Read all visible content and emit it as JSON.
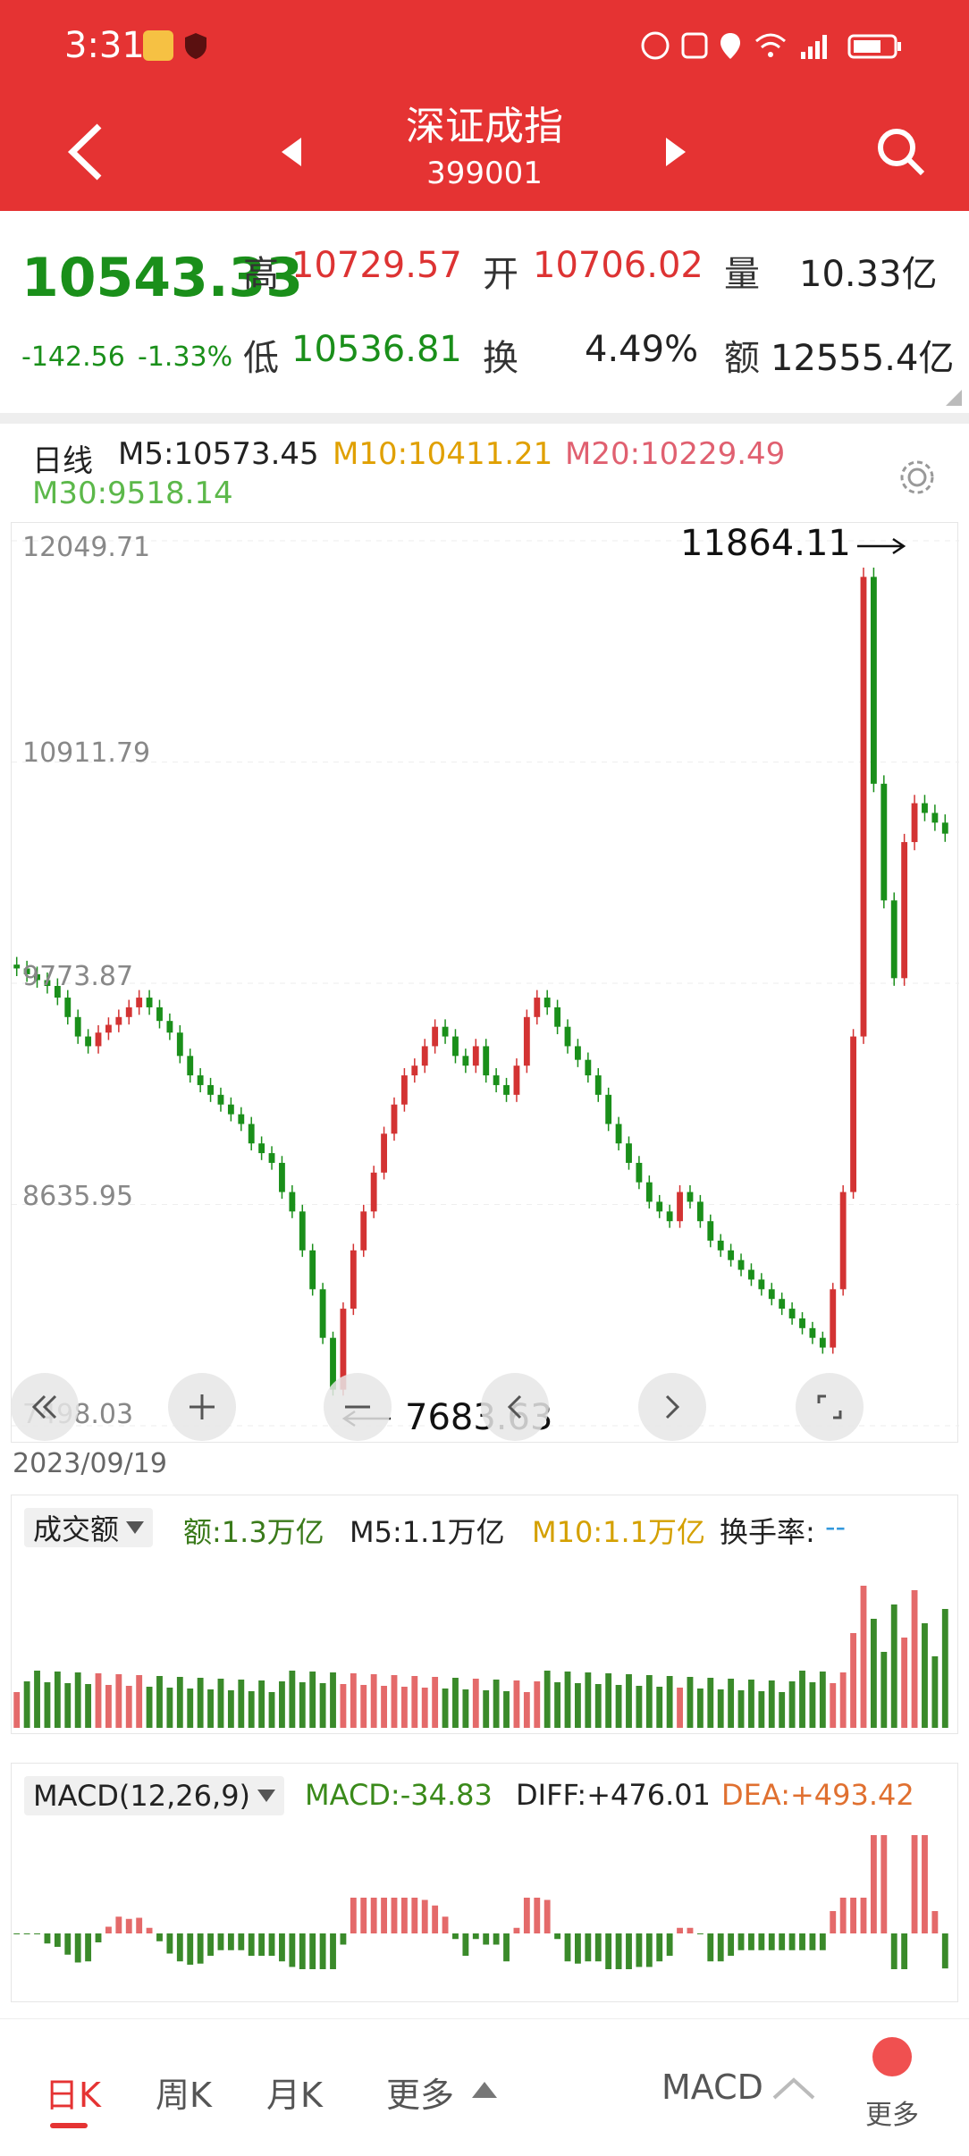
{
  "status": {
    "time": "3:31"
  },
  "nav": {
    "title": "深证成指",
    "code": "399001"
  },
  "quote": {
    "price": "10543.33",
    "change": "-142.56",
    "change_pct": "-1.33%",
    "high_label": "高",
    "high": "10729.57",
    "open_label": "开",
    "open": "10706.02",
    "volume_label": "量",
    "volume": "10.33亿",
    "low_label": "低",
    "low": "10536.81",
    "turnover_label": "换",
    "turnover": "4.49%",
    "amount_label": "额",
    "amount": "12555.4亿"
  },
  "ma": {
    "period": "日线",
    "m5": "M5:10573.45",
    "m10": "M10:10411.21",
    "m20": "M20:10229.49",
    "m30": "M30:9518.14"
  },
  "chart_axis": {
    "y_labels": [
      "12049.71",
      "10911.79",
      "9773.87",
      "8635.95",
      "7498.03"
    ],
    "max_marker": "11864.11",
    "min_marker": "7683.63",
    "start_date": "2023/09/19"
  },
  "volume_panel": {
    "selector": "成交额",
    "amount": "额:1.3万亿",
    "m5": "M5:1.1万亿",
    "m10": "M10:1.1万亿",
    "turnover_label": "换手率:",
    "turnover_value": "--"
  },
  "macd_panel": {
    "selector": "MACD(12,26,9)",
    "macd": "MACD:-34.83",
    "diff": "DIFF:+476.01",
    "dea": "DEA:+493.42"
  },
  "bottom_tabs": {
    "day": "日K",
    "week": "周K",
    "month": "月K",
    "more": "更多",
    "indicator": "MACD",
    "more2": "更多"
  },
  "colors": {
    "up": "#d33333",
    "down": "#1a8f1a",
    "m10": "#e0a000",
    "m20": "#e06070",
    "m30": "#5cb84a",
    "brand": "#e53333"
  },
  "chart_data": {
    "type": "candlestick",
    "ylim": [
      7498.03,
      12049.71
    ],
    "series": [
      {
        "name": "K",
        "close": [
          9850,
          9820,
          9790,
          9760,
          9700,
          9600,
          9500,
          9450,
          9520,
          9560,
          9600,
          9650,
          9700,
          9650,
          9580,
          9520,
          9400,
          9300,
          9250,
          9200,
          9150,
          9100,
          9050,
          8950,
          8900,
          8850,
          8700,
          8600,
          8400,
          8200,
          7950,
          7683.63,
          8100,
          8400,
          8600,
          8800,
          9000,
          9150,
          9300,
          9350,
          9450,
          9550,
          9500,
          9400,
          9350,
          9450,
          9300,
          9250,
          9200,
          9350,
          9600,
          9700,
          9650,
          9550,
          9450,
          9380,
          9300,
          9200,
          9050,
          8950,
          8850,
          8750,
          8650,
          8600,
          8550,
          8700,
          8650,
          8550,
          8450,
          8400,
          8350,
          8300,
          8250,
          8200,
          8150,
          8100,
          8050,
          8000,
          7950,
          7900,
          8200,
          8700,
          9500,
          11864.11,
          10800,
          10200,
          9800,
          10500,
          10700,
          10650,
          10600,
          10543.33
        ]
      }
    ]
  }
}
